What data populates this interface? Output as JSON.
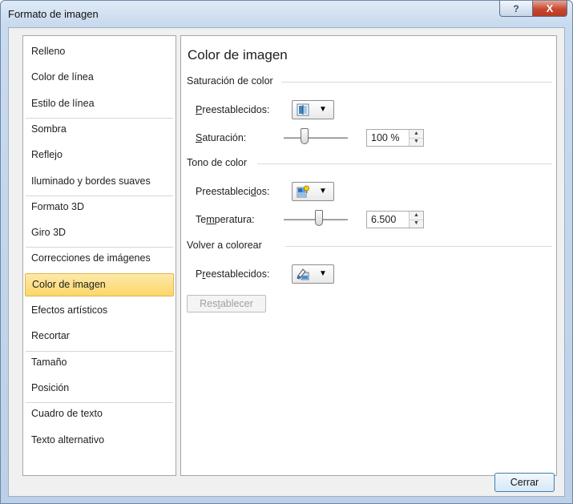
{
  "window": {
    "title": "Formato de imagen",
    "help_glyph": "?",
    "close_glyph": "X"
  },
  "sidebar": {
    "items": [
      {
        "label": "Relleno"
      },
      {
        "label": "Color de línea"
      },
      {
        "label": "Estilo de línea"
      },
      {
        "label": "Sombra"
      },
      {
        "label": "Reflejo"
      },
      {
        "label": "Iluminado y bordes suaves"
      },
      {
        "label": "Formato 3D"
      },
      {
        "label": "Giro 3D"
      },
      {
        "label": "Correcciones de imágenes"
      },
      {
        "label": "Color de imagen",
        "selected": true
      },
      {
        "label": "Efectos artísticos"
      },
      {
        "label": "Recortar"
      },
      {
        "label": "Tamaño"
      },
      {
        "label": "Posición"
      },
      {
        "label": "Cuadro de texto"
      },
      {
        "label": "Texto alternativo"
      }
    ]
  },
  "panel": {
    "heading": "Color de imagen",
    "saturation": {
      "group_label": "Saturación de color",
      "presets_label_pre": "",
      "presets_label_u": "P",
      "presets_label_post": "reestablecidos:",
      "presets_icon": "saturation-preset-icon",
      "value_label_u": "S",
      "value_label_post": "aturación:",
      "value": "100 %",
      "slider_fraction": 0.33
    },
    "tone": {
      "group_label": "Tono de color",
      "presets_label_pre": "Preestableci",
      "presets_label_u": "d",
      "presets_label_post": "os:",
      "presets_icon": "tone-preset-icon",
      "value_label_pre": "Te",
      "value_label_u": "m",
      "value_label_post": "peratura:",
      "value": "6.500",
      "slider_fraction": 0.55
    },
    "recolor": {
      "group_label": "Volver a colorear",
      "presets_label_pre": "P",
      "presets_label_u": "r",
      "presets_label_post": "eestablecidos:",
      "presets_icon": "recolor-preset-icon"
    },
    "reset": {
      "label_pre": "Res",
      "label_u": "t",
      "label_post": "ablecer"
    }
  },
  "footer": {
    "close_label": "Cerrar"
  },
  "colors": {
    "selected_item": "#fbd769",
    "close_accent": "#c7482e",
    "button_border": "#3c7fb1"
  }
}
